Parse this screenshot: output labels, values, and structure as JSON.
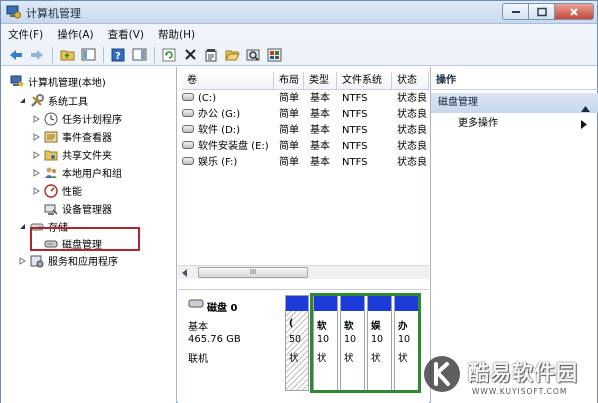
{
  "window": {
    "title": "计算机管理"
  },
  "menu": [
    "文件(F)",
    "操作(A)",
    "查看(V)",
    "帮助(H)"
  ],
  "tree": {
    "root": "计算机管理(本地)",
    "system_tools": "系统工具",
    "task_scheduler": "任务计划程序",
    "event_viewer": "事件查看器",
    "shared_folders": "共享文件夹",
    "local_users": "本地用户和组",
    "performance": "性能",
    "device_manager": "设备管理器",
    "storage": "存储",
    "disk_management": "磁盘管理",
    "services": "服务和应用程序"
  },
  "volume_table": {
    "headers": [
      "卷",
      "布局",
      "类型",
      "文件系统",
      "状态"
    ],
    "rows": [
      [
        "(C:)",
        "简单",
        "基本",
        "NTFS",
        "状态良"
      ],
      [
        "办公 (G:)",
        "简单",
        "基本",
        "NTFS",
        "状态良"
      ],
      [
        "软件 (D:)",
        "简单",
        "基本",
        "NTFS",
        "状态良"
      ],
      [
        "软件安装盘 (E:)",
        "简单",
        "基本",
        "NTFS",
        "状态良"
      ],
      [
        "娱乐 (F:)",
        "简单",
        "基本",
        "NTFS",
        "状态良"
      ]
    ]
  },
  "scrollbar_thumb": "III",
  "disk": {
    "name": "磁盘 0",
    "type": "基本",
    "size": "465.76 GB",
    "status": "联机",
    "partitions": [
      {
        "l1": "(",
        "l2": "50",
        "l3": "状"
      },
      {
        "l1": "软",
        "l2": "10",
        "l3": "状"
      },
      {
        "l1": "软",
        "l2": "10",
        "l3": "状"
      },
      {
        "l1": "娱",
        "l2": "10",
        "l3": "状"
      },
      {
        "l1": "办",
        "l2": "10",
        "l3": "状"
      }
    ]
  },
  "actions": {
    "header": "操作",
    "section": "磁盘管理",
    "more": "更多操作"
  },
  "watermark": {
    "text": "酷易软件园",
    "url": "WWW.KUYISOFT.COM"
  },
  "colors": {
    "partition_band": "#1d3bd9",
    "extended_border": "#2f8a2f",
    "selection_border": "#b0262a"
  }
}
